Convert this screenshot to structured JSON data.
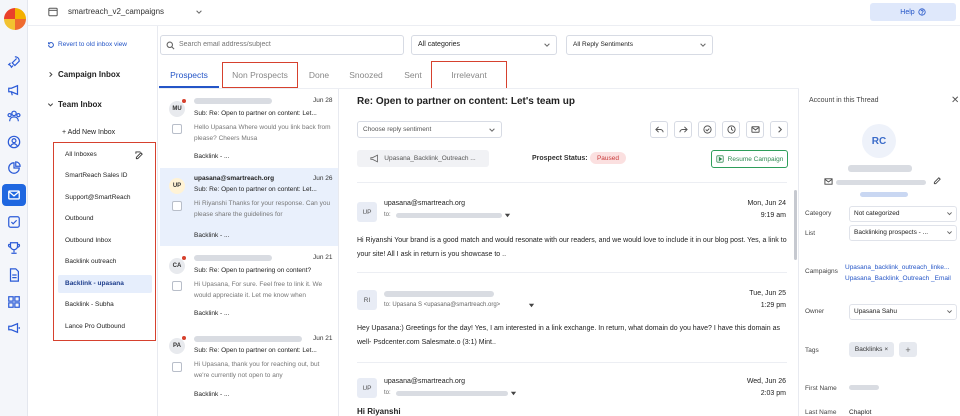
{
  "header": {
    "campaign_name": "smartreach_v2_campaigns",
    "help_label": "Help"
  },
  "left_panel": {
    "revert_link": "Revert to old inbox view",
    "campaign_inbox": "Campaign Inbox",
    "team_inbox": "Team Inbox",
    "add_new_inbox": "+ Add New Inbox",
    "inboxes": [
      "All Inboxes",
      "SmartReach Sales ID",
      "Support@SmartReach",
      "Outbound",
      "Outbound Inbox",
      "Backlink outreach",
      "Backlink - upasana",
      "Backlink - Subha",
      "Lance Pro Outbound"
    ],
    "selected_index": 6
  },
  "search": {
    "placeholder": "Search email address/subject",
    "category_filter": "All categories",
    "sentiment_filter": "All Reply Sentiments"
  },
  "tabs": [
    "Prospects",
    "Non Prospects",
    "Done",
    "Snoozed",
    "Sent",
    "Irrelevant"
  ],
  "conversations": [
    {
      "initials": "MU",
      "date": "Jun 28",
      "subject": "Sub: Re: Open to partner on content: Let...",
      "preview": "Hello Upasana Where would you link back from please? Cheers Musa",
      "tag": "Backlink - ..."
    },
    {
      "initials": "UP",
      "sender": "upasana@smartreach.org",
      "date": "Jun 26",
      "subject": "Sub: Re: Open to partner on content: Let...",
      "preview": "Hi Riyanshi Thanks for your response. Can you please share the guidelines for",
      "tag": "Backlink - ..."
    },
    {
      "initials": "CA",
      "date": "Jun 21",
      "subject": "Sub: Re: Open to partnering on content?",
      "preview": "Hi Upasana, For sure. Feel free to link it. We would appreciate it. Let me know when",
      "tag": "Backlink - ..."
    },
    {
      "initials": "PA",
      "date": "Jun 21",
      "subject": "Sub: Re: Open to partner on content: Let...",
      "preview": "Hi Upasana, thank you for reaching out, but we're currently not open to any",
      "tag": "Backlink - ..."
    }
  ],
  "thread": {
    "title": "Re: Open to partner on content: Let's team up",
    "reply_sentiment_placeholder": "Choose reply sentiment",
    "campaign_chip": "Upasana_Backlink_Outreach ...",
    "prospect_status_label": "Prospect Status:",
    "prospect_status": "Paused",
    "resume_button": "Resume Campaign",
    "messages": [
      {
        "initials": "UP",
        "from": "upasana@smartreach.org",
        "to": "to:",
        "date": "Mon, Jun 24",
        "time": "9:19 am",
        "body": "Hi Riyanshi Your brand is a good match and would resonate with our readers, and we would love to include it in our blog post. Yes, a link to your site! All I ask in return is you showcase to .."
      },
      {
        "initials": "RI",
        "to": "to: Upasana S <upasana@smartreach.org>",
        "date": "Tue, Jun 25",
        "time": "1:29 pm",
        "body": "Hey Upasana:) Greetings for the day! Yes, I am interested in a link exchange. In return, what domain do you have? I have this domain as well- Psdcenter.com Salesmate.o (3:1) Mint.."
      },
      {
        "initials": "UP",
        "from": "upasana@smartreach.org",
        "to": "to:",
        "date": "Wed, Jun 26",
        "time": "2:03 pm",
        "body": "Hi Riyanshi"
      }
    ]
  },
  "account": {
    "title": "Account in this Thread",
    "initials": "RC",
    "category_label": "Category",
    "category_value": "Not categorized",
    "list_label": "List",
    "list_value": "Backlinking prospects - ...",
    "campaigns_label": "Campaigns",
    "campaigns": [
      "Upasana_backlink_outreach_linke...",
      "Upasana_Backlink_Outreach _Email"
    ],
    "owner_label": "Owner",
    "owner_value": "Upasana Sahu",
    "tags_label": "Tags",
    "tag": "Backlinks",
    "first_name_label": "First Name",
    "last_name_label": "Last Name",
    "last_name_value": "Chaplot"
  }
}
